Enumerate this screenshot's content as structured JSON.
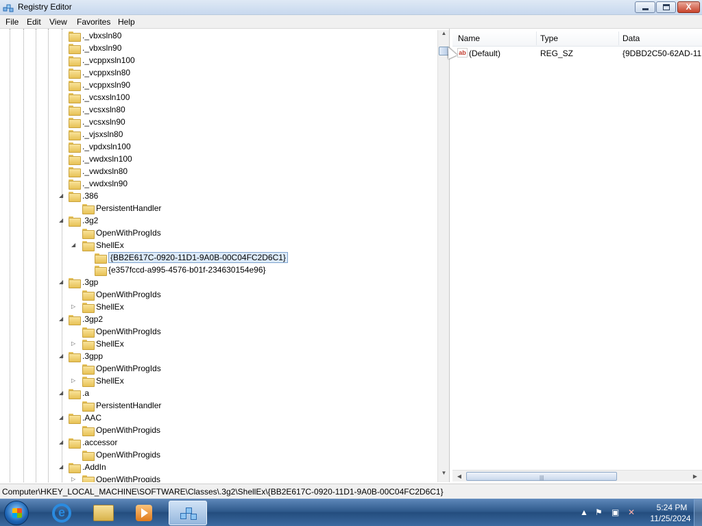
{
  "window": {
    "title": "Registry Editor",
    "controls": {
      "minimize": "",
      "maximize": "",
      "close": "X"
    }
  },
  "menu": [
    "File",
    "Edit",
    "View",
    "Favorites",
    "Help"
  ],
  "tree": {
    "rows": [
      {
        "label": "._vbxsln80",
        "level": 3,
        "arrow": ""
      },
      {
        "label": "._vbxsln90",
        "level": 3,
        "arrow": ""
      },
      {
        "label": "._vcppxsln100",
        "level": 3,
        "arrow": ""
      },
      {
        "label": "._vcppxsln80",
        "level": 3,
        "arrow": ""
      },
      {
        "label": "._vcppxsln90",
        "level": 3,
        "arrow": ""
      },
      {
        "label": "._vcsxsln100",
        "level": 3,
        "arrow": ""
      },
      {
        "label": "._vcsxsln80",
        "level": 3,
        "arrow": ""
      },
      {
        "label": "._vcsxsln90",
        "level": 3,
        "arrow": ""
      },
      {
        "label": "._vjsxsln80",
        "level": 3,
        "arrow": ""
      },
      {
        "label": "._vpdxsln100",
        "level": 3,
        "arrow": ""
      },
      {
        "label": "._vwdxsln100",
        "level": 3,
        "arrow": ""
      },
      {
        "label": "._vwdxsln80",
        "level": 3,
        "arrow": ""
      },
      {
        "label": "._vwdxsln90",
        "level": 3,
        "arrow": ""
      },
      {
        "label": ".386",
        "level": 3,
        "arrow": "expanded"
      },
      {
        "label": "PersistentHandler",
        "level": 4,
        "arrow": ""
      },
      {
        "label": ".3g2",
        "level": 3,
        "arrow": "expanded"
      },
      {
        "label": "OpenWithProgIds",
        "level": 4,
        "arrow": ""
      },
      {
        "label": "ShellEx",
        "level": 4,
        "arrow": "expanded"
      },
      {
        "label": "{BB2E617C-0920-11D1-9A0B-00C04FC2D6C1}",
        "level": 5,
        "arrow": "",
        "selected": true
      },
      {
        "label": "{e357fccd-a995-4576-b01f-234630154e96}",
        "level": 5,
        "arrow": ""
      },
      {
        "label": ".3gp",
        "level": 3,
        "arrow": "expanded"
      },
      {
        "label": "OpenWithProgIds",
        "level": 4,
        "arrow": ""
      },
      {
        "label": "ShellEx",
        "level": 4,
        "arrow": "collapsed"
      },
      {
        "label": ".3gp2",
        "level": 3,
        "arrow": "expanded"
      },
      {
        "label": "OpenWithProgIds",
        "level": 4,
        "arrow": ""
      },
      {
        "label": "ShellEx",
        "level": 4,
        "arrow": "collapsed"
      },
      {
        "label": ".3gpp",
        "level": 3,
        "arrow": "expanded"
      },
      {
        "label": "OpenWithProgIds",
        "level": 4,
        "arrow": ""
      },
      {
        "label": "ShellEx",
        "level": 4,
        "arrow": "collapsed"
      },
      {
        "label": ".a",
        "level": 3,
        "arrow": "expanded"
      },
      {
        "label": "PersistentHandler",
        "level": 4,
        "arrow": ""
      },
      {
        "label": ".AAC",
        "level": 3,
        "arrow": "expanded"
      },
      {
        "label": "OpenWithProgids",
        "level": 4,
        "arrow": ""
      },
      {
        "label": ".accessor",
        "level": 3,
        "arrow": "expanded"
      },
      {
        "label": "OpenWithProgids",
        "level": 4,
        "arrow": ""
      },
      {
        "label": ".AddIn",
        "level": 3,
        "arrow": "expanded"
      },
      {
        "label": "OpenWithProgids",
        "level": 4,
        "arrow": "collapsed"
      }
    ]
  },
  "list": {
    "columns": [
      "Name",
      "Type",
      "Data"
    ],
    "rows": [
      {
        "icon": "ab",
        "name": "(Default)",
        "type": "REG_SZ",
        "data": "{9DBD2C50-62AD-11D"
      }
    ]
  },
  "statusbar": {
    "path": "Computer\\HKEY_LOCAL_MACHINE\\SOFTWARE\\Classes\\.3g2\\ShellEx\\{BB2E617C-0920-11D1-9A0B-00C04FC2D6C1}"
  },
  "taskbar": {
    "items": [
      {
        "name": "internet-explorer-icon"
      },
      {
        "name": "windows-explorer-icon"
      },
      {
        "name": "media-player-icon"
      },
      {
        "name": "registry-editor-icon",
        "active": true
      }
    ],
    "tray": {
      "time": "5:24 PM",
      "date": "11/25/2024"
    }
  },
  "colors": {
    "selection_border": "#7da2ce",
    "selection_fill": "#dceaf9",
    "taskbar": "#2f5a8c"
  }
}
